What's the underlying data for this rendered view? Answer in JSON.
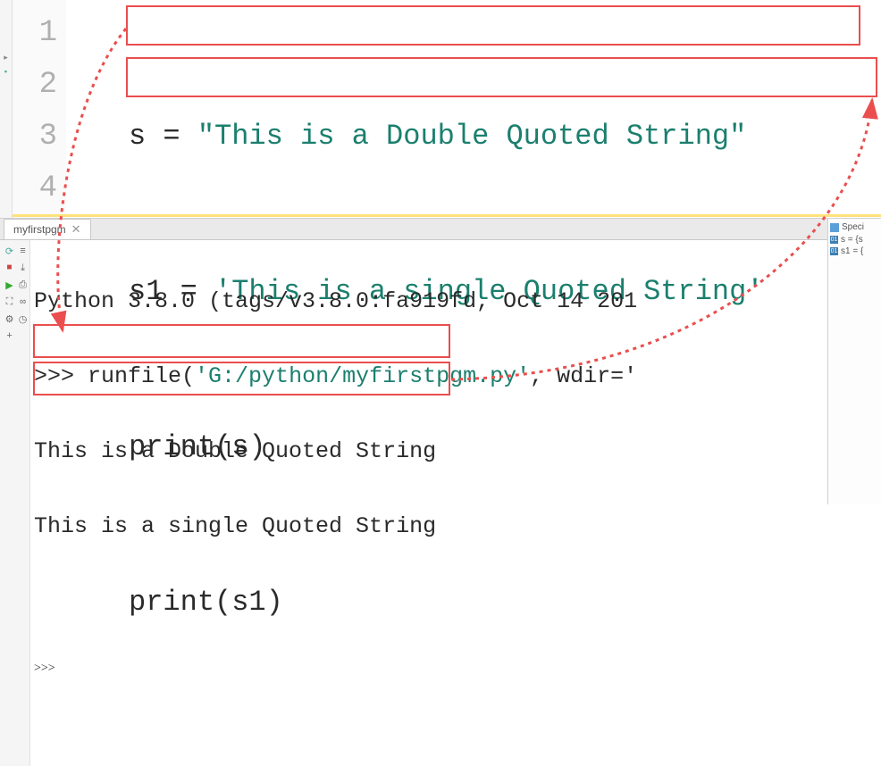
{
  "editor": {
    "lines": {
      "l1": "1",
      "l2": "2",
      "l3": "3",
      "l4": "4"
    },
    "code": {
      "s_var": "s",
      "eq": " = ",
      "s_str": "\"This is a Double Quoted String\"",
      "s1_var": "s1",
      "s1_str": "'This is a single Quoted String'",
      "print": "print",
      "arg_s": "s",
      "arg_s1": "s1",
      "open": "(",
      "close": ")"
    }
  },
  "tab": {
    "label": "myfirstpgm",
    "close": "✕"
  },
  "console": {
    "banner": "Python 3.8.0 (tags/v3.8.0:fa919fd, Oct 14 201",
    "prompt": ">>> ",
    "run": "runfile(",
    "runpath": "'G:/python/myfirstpgm.py'",
    "runtail": ", wdir='",
    "out1": "This is a Double Quoted String",
    "out2": "This is a single Quoted String",
    "prompt2": ">>>"
  },
  "right": {
    "head": "Speci",
    "v1": "s = {s",
    "v2": "s1 = {"
  }
}
